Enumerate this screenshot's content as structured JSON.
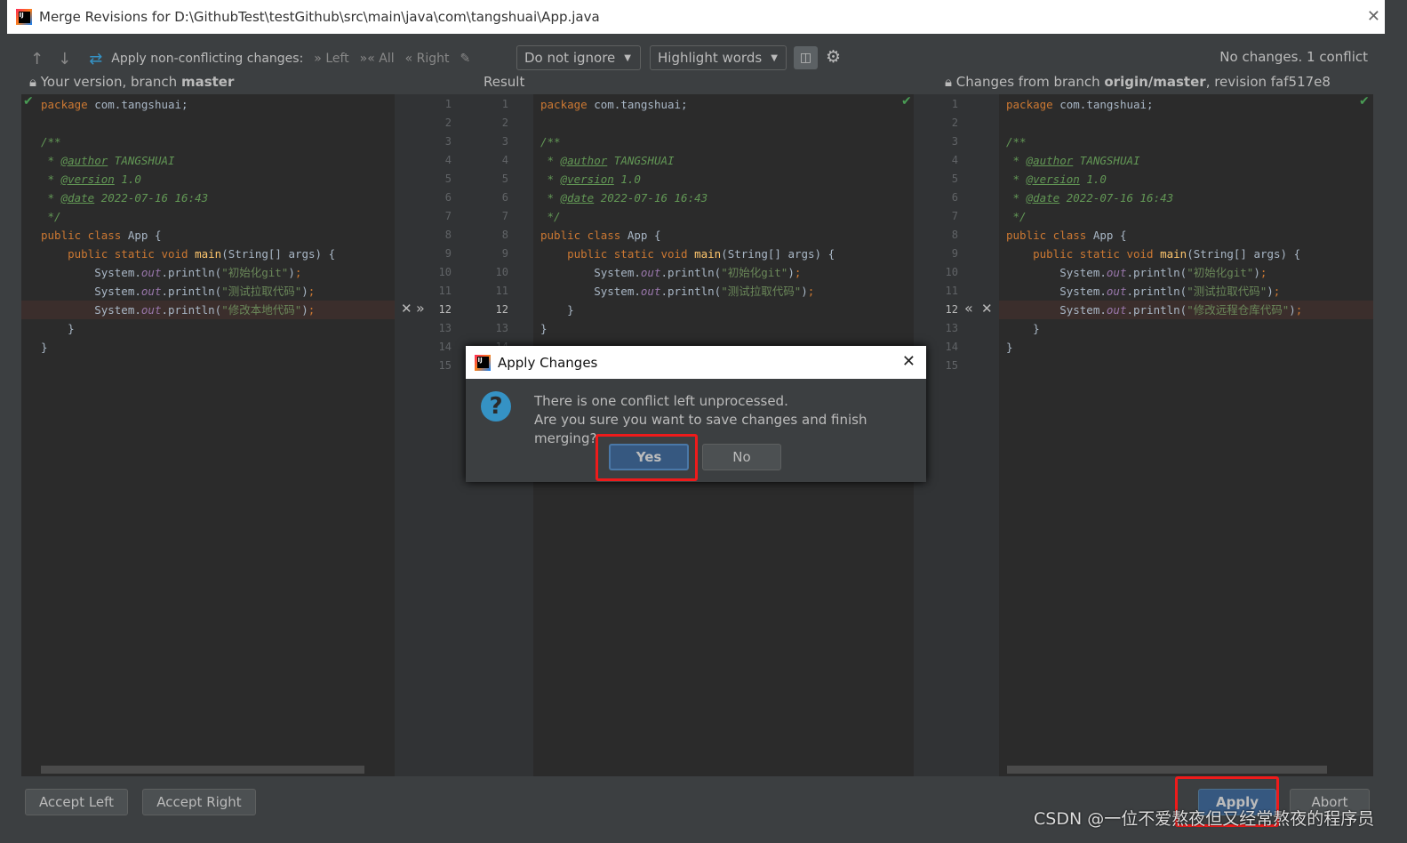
{
  "window": {
    "title": "Merge Revisions for D:\\GithubTest\\testGithub\\src\\main\\java\\com\\tangshuai\\App.java"
  },
  "toolbar": {
    "apply_label": "Apply non-conflicting changes:",
    "left": "Left",
    "all": "All",
    "right": "Right",
    "whitespace": "Do not ignore",
    "highlight": "Highlight words",
    "status": "No changes. 1 conflict"
  },
  "headers": {
    "left_prefix": "Your version, branch ",
    "left_branch": "master",
    "middle": "Result",
    "right_prefix": "Changes from branch ",
    "right_branch": "origin/master",
    "right_suffix": ", revision faf517e8"
  },
  "left_lines": [
    [
      [
        "kw",
        "package "
      ],
      [
        "",
        "com.tangshuai;"
      ]
    ],
    [],
    [
      [
        "cm",
        "/**"
      ]
    ],
    [
      [
        "cm",
        " * "
      ],
      [
        "tag",
        "@author"
      ],
      [
        "cm",
        " TANGSHUAI"
      ]
    ],
    [
      [
        "cm",
        " * "
      ],
      [
        "tag",
        "@version"
      ],
      [
        "cm",
        " 1.0"
      ]
    ],
    [
      [
        "cm",
        " * "
      ],
      [
        "tag",
        "@date"
      ],
      [
        "cm",
        " 2022-07-16 16:43"
      ]
    ],
    [
      [
        "cm",
        " */"
      ]
    ],
    [
      [
        "kw",
        "public class "
      ],
      [
        "",
        "App {"
      ]
    ],
    [
      [
        "kw",
        "    public static void "
      ],
      [
        "fn",
        "main"
      ],
      [
        "",
        "(String[] args) {"
      ]
    ],
    [
      [
        "",
        "        System."
      ],
      [
        "fld",
        "out"
      ],
      [
        "",
        ".println("
      ],
      [
        "str",
        "\"初始化git\""
      ],
      [
        "",
        ")"
      ],
      [
        "kw",
        ";"
      ]
    ],
    [
      [
        "",
        "        System."
      ],
      [
        "fld",
        "out"
      ],
      [
        "",
        ".println("
      ],
      [
        "str",
        "\"测试拉取代码\""
      ],
      [
        "",
        ")"
      ],
      [
        "kw",
        ";"
      ]
    ],
    [
      [
        "",
        "        System."
      ],
      [
        "fld",
        "out"
      ],
      [
        "",
        ".println("
      ],
      [
        "str",
        "\"修改本地代码\""
      ],
      [
        "",
        ")"
      ],
      [
        "kw",
        ";"
      ]
    ],
    [
      [
        "",
        "    }"
      ]
    ],
    [
      [
        "",
        "}"
      ]
    ]
  ],
  "result_lines": [
    [
      [
        "kw",
        "package "
      ],
      [
        "",
        "com.tangshuai;"
      ]
    ],
    [],
    [
      [
        "cm",
        "/**"
      ]
    ],
    [
      [
        "cm",
        " * "
      ],
      [
        "tag",
        "@author"
      ],
      [
        "cm",
        " TANGSHUAI"
      ]
    ],
    [
      [
        "cm",
        " * "
      ],
      [
        "tag",
        "@version"
      ],
      [
        "cm",
        " 1.0"
      ]
    ],
    [
      [
        "cm",
        " * "
      ],
      [
        "tag",
        "@date"
      ],
      [
        "cm",
        " 2022-07-16 16:43"
      ]
    ],
    [
      [
        "cm",
        " */"
      ]
    ],
    [
      [
        "kw",
        "public class "
      ],
      [
        "",
        "App {"
      ]
    ],
    [
      [
        "kw",
        "    public static void "
      ],
      [
        "fn",
        "main"
      ],
      [
        "",
        "(String[] args) {"
      ]
    ],
    [
      [
        "",
        "        System."
      ],
      [
        "fld",
        "out"
      ],
      [
        "",
        ".println("
      ],
      [
        "str",
        "\"初始化git\""
      ],
      [
        "",
        ")"
      ],
      [
        "kw",
        ";"
      ]
    ],
    [
      [
        "",
        "        System."
      ],
      [
        "fld",
        "out"
      ],
      [
        "",
        ".println("
      ],
      [
        "str",
        "\"测试拉取代码\""
      ],
      [
        "",
        ")"
      ],
      [
        "kw",
        ";"
      ]
    ],
    [
      [
        "",
        "    }"
      ]
    ],
    [
      [
        "",
        "}"
      ]
    ]
  ],
  "right_lines": [
    [
      [
        "kw",
        "package "
      ],
      [
        "",
        "com.tangshuai;"
      ]
    ],
    [],
    [
      [
        "cm",
        "/**"
      ]
    ],
    [
      [
        "cm",
        " * "
      ],
      [
        "tag",
        "@author"
      ],
      [
        "cm",
        " TANGSHUAI"
      ]
    ],
    [
      [
        "cm",
        " * "
      ],
      [
        "tag",
        "@version"
      ],
      [
        "cm",
        " 1.0"
      ]
    ],
    [
      [
        "cm",
        " * "
      ],
      [
        "tag",
        "@date"
      ],
      [
        "cm",
        " 2022-07-16 16:43"
      ]
    ],
    [
      [
        "cm",
        " */"
      ]
    ],
    [
      [
        "kw",
        "public class "
      ],
      [
        "",
        "App {"
      ]
    ],
    [
      [
        "kw",
        "    public static void "
      ],
      [
        "fn",
        "main"
      ],
      [
        "",
        "(String[] args) {"
      ]
    ],
    [
      [
        "",
        "        System."
      ],
      [
        "fld",
        "out"
      ],
      [
        "",
        ".println("
      ],
      [
        "str",
        "\"初始化git\""
      ],
      [
        "",
        ")"
      ],
      [
        "kw",
        ";"
      ]
    ],
    [
      [
        "",
        "        System."
      ],
      [
        "fld",
        "out"
      ],
      [
        "",
        ".println("
      ],
      [
        "str",
        "\"测试拉取代码\""
      ],
      [
        "",
        ")"
      ],
      [
        "kw",
        ";"
      ]
    ],
    [
      [
        "",
        "        System."
      ],
      [
        "fld",
        "out"
      ],
      [
        "",
        ".println("
      ],
      [
        "str",
        "\"修改远程仓库代码\""
      ],
      [
        "",
        ")"
      ],
      [
        "kw",
        ";"
      ]
    ],
    [
      [
        "",
        "    }"
      ]
    ],
    [
      [
        "",
        "}"
      ]
    ]
  ],
  "line_numbers": [
    "1",
    "2",
    "3",
    "4",
    "5",
    "6",
    "7",
    "8",
    "9",
    "10",
    "11",
    "12",
    "13",
    "14",
    "15"
  ],
  "conflict_line": 12,
  "bottom": {
    "accept_left": "Accept Left",
    "accept_right": "Accept Right",
    "apply": "Apply",
    "abort": "Abort"
  },
  "dialog": {
    "title": "Apply Changes",
    "line1": "There is one conflict left unprocessed.",
    "line2": "Are you sure you want to save changes and finish merging?",
    "yes": "Yes",
    "no": "No"
  },
  "watermark": "CSDN @一位不爱熬夜但又经常熬夜的程序员",
  "colors": {
    "accent": "#365880",
    "highlight_box": "#ee1b1b",
    "conflict": "#3b2e2c"
  }
}
